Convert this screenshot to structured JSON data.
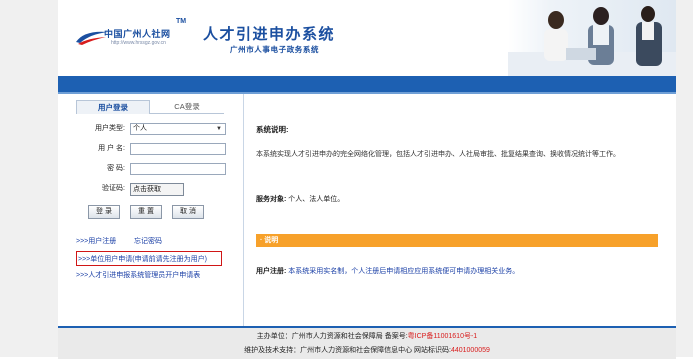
{
  "header": {
    "logo_text": "中国广州人社网",
    "logo_tm": "TM",
    "logo_url": "http://www.hrssgz.gov.cn",
    "title": "人才引进申办系统",
    "subtitle": "广州市人事电子政务系统"
  },
  "login": {
    "tab_user": "用户登录",
    "tab_ca": "CA登录",
    "user_type_label": "用户类型:",
    "user_type_value": "个人",
    "username_label": "用 户 名:",
    "username_value": "",
    "password_label": "密  码:",
    "password_value": "",
    "captcha_label": "验证码:",
    "captcha_value": "",
    "captcha_button": "点击获取",
    "btn_login": "登  录",
    "btn_reset": "重  置",
    "btn_cancel": "取  消",
    "link_register": ">>>用户注册",
    "link_forgot": "忘记密码",
    "link_unit_apply": ">>>单位用户申请(申请前请先注册为用户)",
    "link_admin_apply": ">>>人才引进申报系统管理员开户申请表"
  },
  "content": {
    "desc_title": "系统说明:",
    "desc_text": "本系统实现人才引进申办的完全网络化管理，包括人才引进申办、人社局审批、批复结果查询、换收情况统计等工作。",
    "service_label": "服务对象:",
    "service_value": "个人、法人单位。",
    "notice_bar": "· 说明",
    "reg_label": "用户注册:",
    "reg_text": "本系统采用实名制，个人注册后申请相应应用系统便可申请办理相关业务。"
  },
  "footer": {
    "line1_prefix": "主办单位：广州市人力资源和社会保障局  备案号:",
    "icp": "粤ICP备11001610号-1",
    "line2_prefix": "维护及技术支持：广州市人力资源和社会保障信息中心  网站标识码:",
    "site_code": "4401000059"
  },
  "colors": {
    "brand_blue": "#1d60b2",
    "notice_orange": "#f7a12a",
    "highlight_red": "#d01616"
  }
}
